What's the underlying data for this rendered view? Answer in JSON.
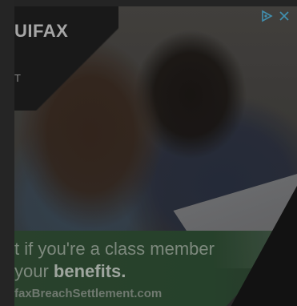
{
  "ad": {
    "brand": "UIFAX",
    "brand_sub": "T",
    "headline_line1": "t if you're a class member",
    "headline_line2_prefix": "your ",
    "headline_line2_bold": "benefits.",
    "url": "faxBreachSettlement.com"
  },
  "controls": {
    "adchoices_icon": "adchoices-icon",
    "close_icon": "close-icon"
  },
  "colors": {
    "accent_green": "#2c4a31",
    "control_blue": "#4aa3c8"
  }
}
